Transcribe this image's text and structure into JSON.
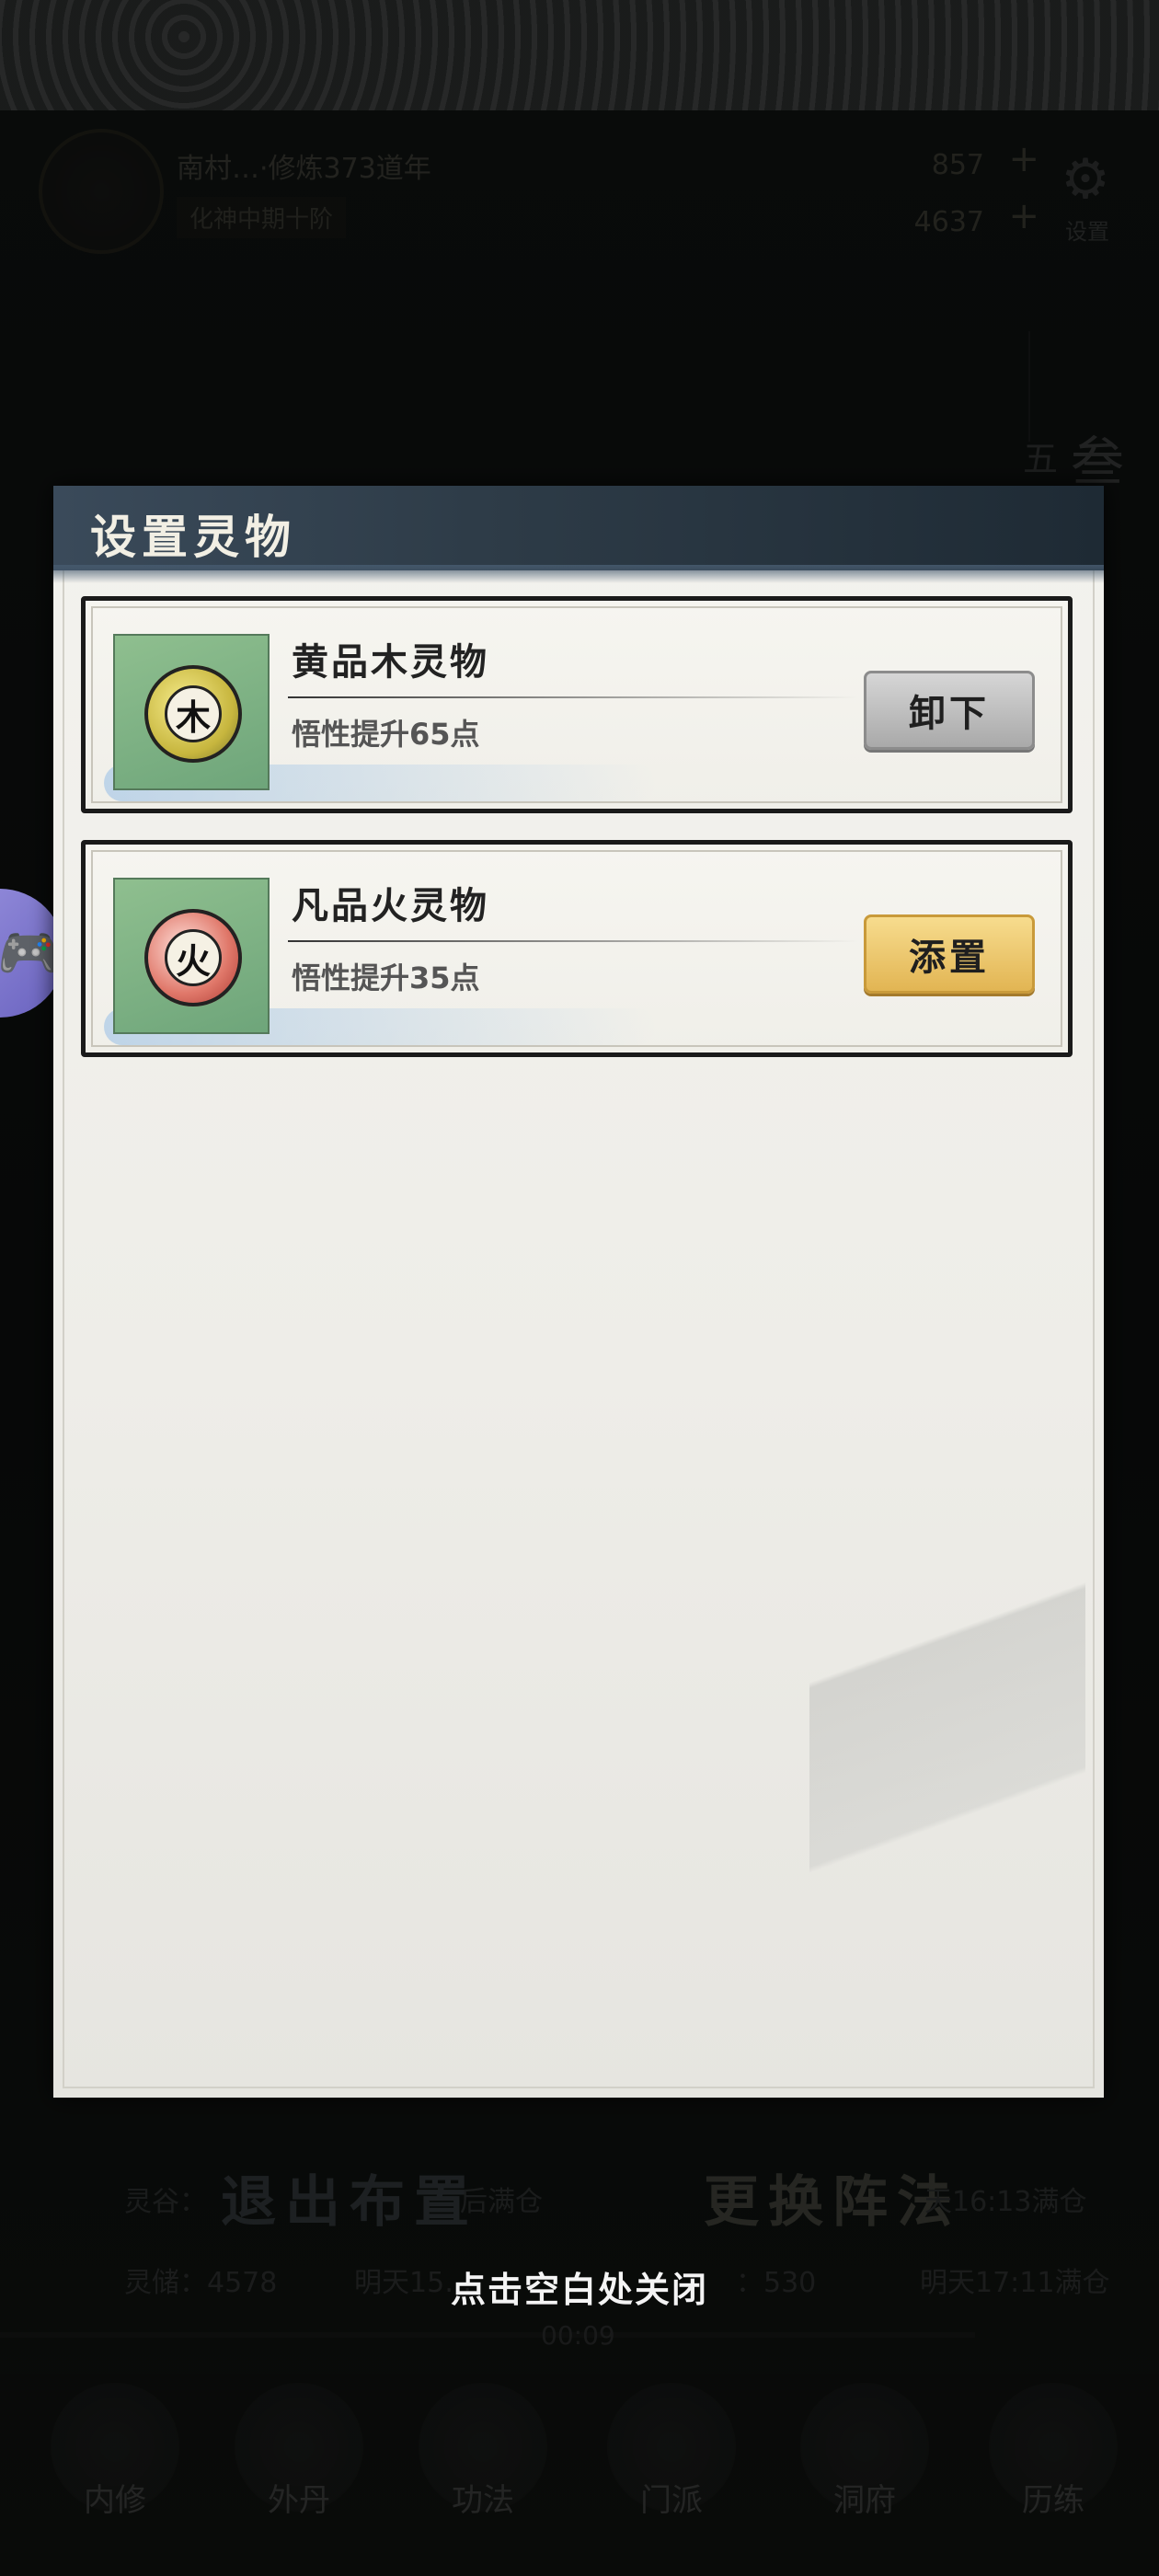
{
  "background": {
    "player_name": "南村…·修炼373道年",
    "realm": "化神中期十阶",
    "resource_1": "857",
    "resource_2": "4637",
    "settings_label": "设置",
    "side_vertical_1": "叁",
    "side_vertical_2": "五",
    "exit_button": "退出布置",
    "change_button": "更换阵法",
    "row1_left": "灵谷：",
    "row1_left_tail": "后满仓",
    "row1_right": "天16:13满仓",
    "row2_left": "灵储：4578",
    "row2_mid": "明天15…",
    "row2_right_label": "：530",
    "row2_right": "明天17:11满仓",
    "timer": "00:09",
    "tabs": [
      {
        "label": "内修"
      },
      {
        "label": "外丹"
      },
      {
        "label": "功法"
      },
      {
        "label": "门派"
      },
      {
        "label": "洞府"
      },
      {
        "label": "历练"
      }
    ]
  },
  "modal": {
    "title": "设置灵物",
    "items": [
      {
        "element": "木",
        "name": "黄品木灵物",
        "effect": "悟性提升65点",
        "button": "卸下",
        "button_style": "gray"
      },
      {
        "element": "火",
        "name": "凡品火灵物",
        "effect": "悟性提升35点",
        "button": "添置",
        "button_style": "gold"
      }
    ]
  },
  "close_hint": "点击空白处关闭",
  "colors": {
    "button_gold": "#e2b553",
    "button_gray": "#a9a9a9",
    "header_blue": "#2e3c48"
  }
}
